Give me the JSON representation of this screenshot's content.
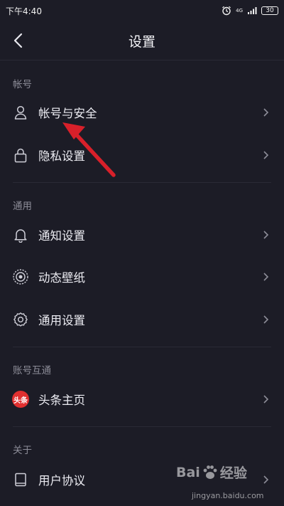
{
  "status_bar": {
    "time": "下午4:40",
    "network": "4G",
    "battery": "30"
  },
  "header": {
    "title": "设置"
  },
  "sections": {
    "account": {
      "title": "帐号",
      "items": [
        {
          "label": "帐号与安全",
          "icon": "person-icon"
        },
        {
          "label": "隐私设置",
          "icon": "lock-icon"
        }
      ]
    },
    "general": {
      "title": "通用",
      "items": [
        {
          "label": "通知设置",
          "icon": "bell-icon"
        },
        {
          "label": "动态壁纸",
          "icon": "wallpaper-icon"
        },
        {
          "label": "通用设置",
          "icon": "gear-icon"
        }
      ]
    },
    "linked": {
      "title": "账号互通",
      "items": [
        {
          "label": "头条主页",
          "icon": "toutiao-logo",
          "logo_text": "头条"
        }
      ]
    },
    "about": {
      "title": "关于",
      "items": [
        {
          "label": "用户协议",
          "icon": "book-icon"
        }
      ]
    }
  },
  "annotation": {
    "arrow_color": "#d8202a"
  },
  "watermark": {
    "brand_a": "Bai",
    "brand_b": "经验",
    "url": "jingyan.baidu.com"
  }
}
